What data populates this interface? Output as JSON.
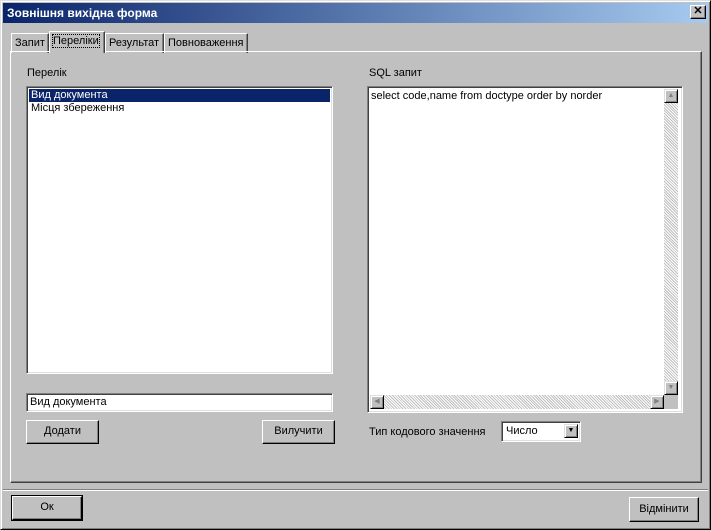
{
  "window": {
    "title": "Зовнішня вихідна форма",
    "close_symbol": "✕"
  },
  "tabs": [
    {
      "label": "Запит",
      "active": false
    },
    {
      "label": "Переліки",
      "active": true
    },
    {
      "label": "Результат",
      "active": false
    },
    {
      "label": "Повноваження",
      "active": false
    }
  ],
  "lists_panel": {
    "label": "Перелік",
    "items": [
      {
        "label": "Вид документа",
        "selected": true
      },
      {
        "label": "Місця збереження",
        "selected": false
      }
    ],
    "name_input_value": "Вид документа",
    "add_label": "Додати",
    "remove_label": "Вилучити"
  },
  "sql_panel": {
    "label": "SQL запит",
    "query": "select code,name from doctype order by norder",
    "code_type_label": "Тип кодового значення",
    "code_type_selected": "Число"
  },
  "footer": {
    "ok_label": "Ок",
    "cancel_label": "Відмінити"
  },
  "icons": {
    "scroll_up": "▲",
    "scroll_down": "▼",
    "scroll_left": "◀",
    "scroll_right": "▶",
    "combo_arrow": "▼"
  },
  "colors": {
    "title_bar": "#0a246a",
    "selection": "#0a246a",
    "face": "#c0c0c0"
  }
}
